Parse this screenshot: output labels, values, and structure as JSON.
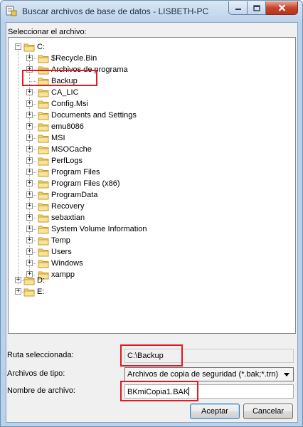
{
  "window": {
    "title": "Buscar archivos de base de datos - LISBETH-PC"
  },
  "labels": {
    "select_file": "Seleccionar el archivo:",
    "selected_path": "Ruta seleccionada:",
    "file_types": "Archivos de tipo:",
    "file_name": "Nombre de archivo:"
  },
  "tree": {
    "root_c": "C:",
    "children": [
      "$Recycle.Bin",
      "Archivos de programa",
      "Backup",
      "CA_LIC",
      "Config.Msi",
      "Documents and Settings",
      "emu8086",
      "MSI",
      "MSOCache",
      "PerfLogs",
      "Program Files",
      "Program Files (x86)",
      "ProgramData",
      "Recovery",
      "sebaxtian",
      "System Volume Information",
      "Temp",
      "Users",
      "Windows",
      "xampp"
    ],
    "root_d": "D:",
    "root_e": "E:"
  },
  "fields": {
    "selected_path_value": "C:\\Backup",
    "file_type_value": "Archivos de copia de seguridad (*.bak;*.trn)",
    "file_name_value": "BKmiCopia1.BAK"
  },
  "buttons": {
    "accept": "Aceptar",
    "cancel": "Cancelar"
  },
  "colors": {
    "highlight": "#e11922",
    "titlebar": "#bcd2ea",
    "close_button": "#c6462d"
  },
  "icons": [
    "database-app-icon",
    "minimize-icon",
    "maximize-icon",
    "close-icon",
    "folder-icon",
    "expand-icon",
    "collapse-icon",
    "dropdown-arrow-icon"
  ]
}
